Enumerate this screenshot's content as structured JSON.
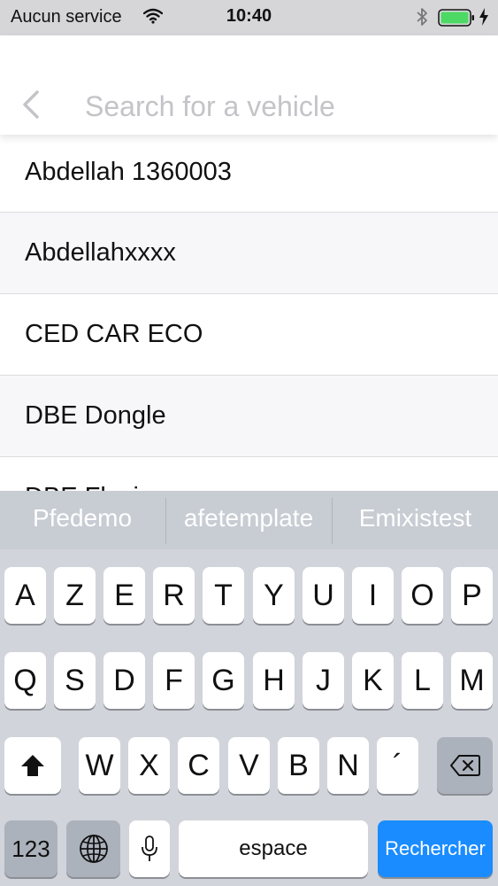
{
  "status_bar": {
    "carrier": "Aucun service",
    "time": "10:40"
  },
  "search": {
    "placeholder": "Search for a vehicle",
    "value": ""
  },
  "vehicles": [
    "Abdellah 1360003",
    "Abdellahxxxx",
    "CED CAR ECO",
    "DBE Dongle",
    "DBE Flexi"
  ],
  "keyboard": {
    "suggestions": [
      "Pfedemo",
      "afetemplate",
      "Emixistest"
    ],
    "row1": [
      "A",
      "Z",
      "E",
      "R",
      "T",
      "Y",
      "U",
      "I",
      "O",
      "P"
    ],
    "row2": [
      "Q",
      "S",
      "D",
      "F",
      "G",
      "H",
      "J",
      "K",
      "L",
      "M"
    ],
    "row3": [
      "W",
      "X",
      "C",
      "V",
      "B",
      "N",
      "´"
    ],
    "numbers_label": "123",
    "space_label": "espace",
    "return_label": "Rechercher"
  },
  "colors": {
    "accent": "#1a8cff",
    "battery": "#4cd964"
  }
}
